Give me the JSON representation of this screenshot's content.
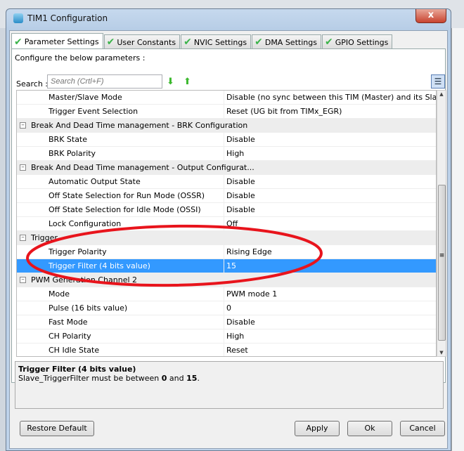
{
  "window": {
    "title": "TIM1 Configuration",
    "close": "x"
  },
  "tabs": [
    "Parameter Settings",
    "User Constants",
    "NVIC Settings",
    "DMA Settings",
    "GPIO Settings"
  ],
  "configure_label": "Configure the below parameters :",
  "search": {
    "label": "Search :",
    "placeholder": "Search (Crtl+F)"
  },
  "rows": [
    {
      "type": "item",
      "name": "Master/Slave Mode",
      "value": "Disable (no sync between this TIM (Master) and its Slaves"
    },
    {
      "type": "item",
      "name": "Trigger Event Selection",
      "value": "Reset (UG bit from TIMx_EGR)"
    },
    {
      "type": "group",
      "name": "Break And Dead Time management - BRK Configuration"
    },
    {
      "type": "item",
      "name": "BRK State",
      "value": "Disable"
    },
    {
      "type": "item",
      "name": "BRK Polarity",
      "value": "High"
    },
    {
      "type": "group",
      "name": "Break And Dead Time management - Output Configurat..."
    },
    {
      "type": "item",
      "name": "Automatic Output State",
      "value": "Disable"
    },
    {
      "type": "item",
      "name": "Off State Selection for Run Mode (OSSR)",
      "value": "Disable"
    },
    {
      "type": "item",
      "name": "Off State Selection for Idle Mode (OSSI)",
      "value": "Disable"
    },
    {
      "type": "item",
      "name": "Lock Configuration",
      "value": "Off"
    },
    {
      "type": "group",
      "name": "Trigger"
    },
    {
      "type": "item",
      "name": "Trigger Polarity",
      "value": "Rising Edge"
    },
    {
      "type": "item",
      "name": "Trigger Filter (4 bits value)",
      "value": "15",
      "selected": true
    },
    {
      "type": "group",
      "name": "PWM Generation Channel 2"
    },
    {
      "type": "item",
      "name": "Mode",
      "value": "PWM mode 1"
    },
    {
      "type": "item",
      "name": "Pulse (16 bits value)",
      "value": "0"
    },
    {
      "type": "item",
      "name": "Fast Mode",
      "value": "Disable"
    },
    {
      "type": "item",
      "name": "CH Polarity",
      "value": "High"
    },
    {
      "type": "item",
      "name": "CH Idle State",
      "value": "Reset"
    }
  ],
  "description": {
    "title": "Trigger Filter (4 bits value)",
    "pre": "Slave_TriggerFilter must be between ",
    "min": "0",
    "mid": " and ",
    "max": "15",
    "post": "."
  },
  "buttons": {
    "restore": "Restore Default",
    "apply": "Apply",
    "ok": "Ok",
    "cancel": "Cancel"
  }
}
